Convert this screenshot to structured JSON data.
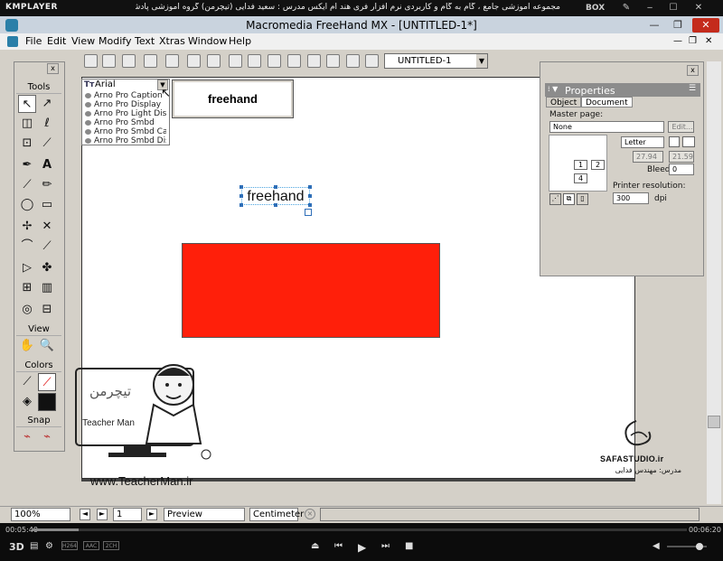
{
  "kmplayer": {
    "logo": "KMPLAYER",
    "title": "مجموعه آموزشی جامع ، گام به گام و کاربردی نرم افزار فری هند ام ایکس  مدرس : سعید فدایی (تیچرمن) گروه آموزشی پادشاه گرافیست ها",
    "box_label": "BOX",
    "time_elapsed": "00:05:40",
    "time_total": "00:06:20",
    "progress": 0.07,
    "badges": [
      "H264",
      "AAC",
      "2CH"
    ],
    "volume": 0.82
  },
  "app": {
    "title": "Macromedia FreeHand MX - [UNTITLED-1*]",
    "menu": [
      "File",
      "Edit",
      "View",
      "Modify",
      "Text",
      "Xtras",
      "Window",
      "Help"
    ],
    "document_select": "UNTITLED-1"
  },
  "tools_panel": {
    "title": "Tools",
    "view_title": "View",
    "colors_title": "Colors",
    "snap_title": "Snap"
  },
  "font_dropdown": {
    "current": "Arial",
    "options": [
      "Arno Pro Caption",
      "Arno Pro Display",
      "Arno Pro Light Disp",
      "Arno Pro Smbd",
      "Arno Pro Smbd Cap",
      "Arno Pro Smbd Disp"
    ],
    "preview_text": "freehand"
  },
  "canvas": {
    "text_object": "freehand",
    "rect_color": "#ff1f0a"
  },
  "properties": {
    "title": "Properties",
    "tabs": [
      "Object",
      "Document"
    ],
    "master_page_label": "Master page:",
    "master_page_value": "None",
    "edit_button": "Edit...",
    "page_size": "Letter",
    "width": "27.94",
    "height": "21.59",
    "bleed_label": "Bleed:",
    "bleed_value": "0",
    "printer_res_label": "Printer resolution:",
    "printer_res_value": "300",
    "dpi_label": "dpi",
    "pages": [
      "1",
      "2",
      "4"
    ]
  },
  "statusbar": {
    "zoom": "100%",
    "page": "1",
    "mode": "Preview",
    "units": "Centimeter"
  },
  "watermarks": {
    "teacher_url": "www.TeacherMan.ir",
    "teacher_label": "Teacher Man",
    "teacher_logo_text": "تیچرمن",
    "safa_name": "SAFASTUDIO.ir",
    "safa_sub": "مدرس: مهندس فدایی"
  }
}
